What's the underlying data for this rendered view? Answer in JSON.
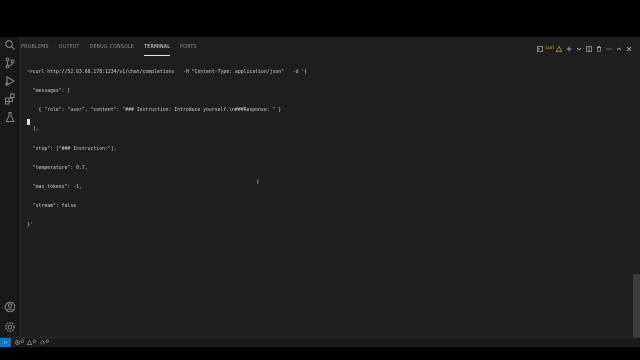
{
  "panel": {
    "tabs": [
      {
        "label": "PROBLEMS"
      },
      {
        "label": "OUTPUT"
      },
      {
        "label": "DEBUG CONSOLE"
      },
      {
        "label": "TERMINAL"
      },
      {
        "label": "PORTS"
      }
    ],
    "active_tab": "TERMINAL",
    "terminal_shell_label": "curl"
  },
  "terminal": {
    "lines": [
      "~>curl http://52.63.68.178:1234/v1/chat/completions   -H \"Content-Type: application/json\"   -d '{",
      "  \"messages\": [",
      "    { \"role\": \"user\", \"content\": \"### Instruction: Introduce yourself.\\n###Response: \" }",
      "  ],",
      "  \"stop\": [\"### Instruction:\"],",
      "  \"temperature\": 0.7,",
      "  \"max_tokens\": -1,",
      "  \"stream\": false",
      "}'"
    ]
  },
  "status_bar": {
    "errors": "0",
    "warnings": "0",
    "ports": "0"
  },
  "colors": {
    "accent": "#0078d4",
    "panel_bg": "#1e1e1e",
    "status_bg": "#1b1b1b"
  },
  "icons": {
    "activity": [
      "search-icon",
      "source-control-icon",
      "run-debug-icon",
      "extensions-icon",
      "testing-icon",
      "account-icon",
      "settings-gear-icon"
    ],
    "panel_actions": [
      "terminal-icon",
      "warning-icon",
      "add-icon",
      "chevron-down-icon",
      "split-icon",
      "trash-icon",
      "ellipsis-icon",
      "maximize-icon",
      "close-icon"
    ]
  }
}
